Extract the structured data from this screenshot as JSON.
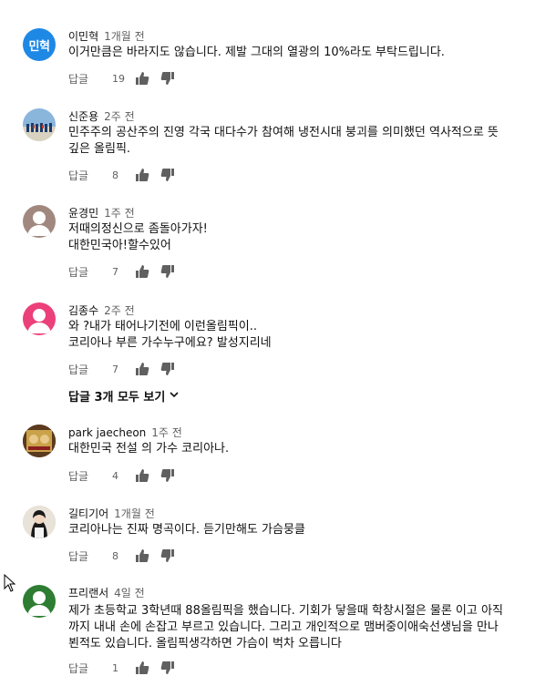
{
  "reply_label": "답글",
  "show_replies_label": "답글 3개 모두 보기",
  "comments": [
    {
      "author": "이민혁",
      "time": "1개월 전",
      "text": "이거만큼은 바라지도 않습니다. 제발 그대의 열광의 10%라도 부탁드립니다.",
      "likes": "19",
      "avatar_text": "민혁",
      "avatar_color": "#1e88e5"
    },
    {
      "author": "신준용",
      "time": "2주 전",
      "text": "민주주의 공산주의 진영 각국 대다수가 참여해 냉전시대 붕괴를 의미했던 역사적으로 뜻\n깊은 올림픽.",
      "likes": "8",
      "avatar_text": "",
      "avatar_color": "#8bb6dc"
    },
    {
      "author": "윤경민",
      "time": "1주 전",
      "text": "저때의정신으로 좀돌아가자!\n대한민국아!할수있어",
      "likes": "7",
      "avatar_text": "",
      "avatar_color": "#a1887f"
    },
    {
      "author": "김종수",
      "time": "2주 전",
      "text": "와 ?내가 태어나기전에 이런올림픽이..\n코리아나 부른 가수누구에요? 발성지리네",
      "likes": "7",
      "avatar_text": "",
      "avatar_color": "#ec407a"
    },
    {
      "author": "park jaecheon",
      "time": "1주 전",
      "text": "대한민국 전설 의 가수 코리아나.",
      "likes": "4",
      "avatar_text": "",
      "avatar_color": "#c9a24a"
    },
    {
      "author": "길티기어",
      "time": "1개월 전",
      "text": "코리아나는 진짜 명곡이다. 듣기만해도 가슴뭉클",
      "likes": "8",
      "avatar_text": "",
      "avatar_color": "#d8cfc4"
    },
    {
      "author": "프리랜서",
      "time": "4일 전",
      "text": "제가 초등학교 3학년때 88올림픽을 했습니다. 기회가 닿을때 학창시절은 물론 이고 아직\n까지 내내 손에 손잡고 부르고 있습니다. 그리고 개인적으로 맴버중이애숙선생님을 만나\n뵌적도 있습니다. 올림픽생각하면 가슴이 벅차 오릅니다",
      "likes": "1",
      "avatar_text": "",
      "avatar_color": "#2e7d32"
    }
  ]
}
